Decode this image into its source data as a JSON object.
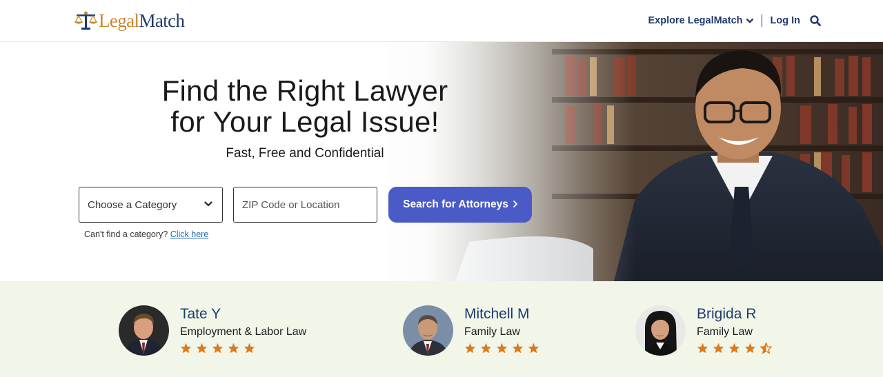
{
  "header": {
    "logo_part1": "Legal",
    "logo_part2": "Match",
    "nav_explore": "Explore LegalMatch",
    "nav_login": "Log In",
    "icons": [
      "scales-icon",
      "chevron-down-icon",
      "search-icon"
    ]
  },
  "hero": {
    "title_line1": "Find the Right Lawyer",
    "title_line2": "for Your Legal Issue!",
    "subtitle": "Fast, Free and Confidential",
    "category_select": "Choose a Category",
    "zip_placeholder": "ZIP Code or Location",
    "search_button": "Search for Attorneys",
    "cant_find_text": "Can't find a category?",
    "cant_find_link": "Click here"
  },
  "lawyers": [
    {
      "name": "Tate Y",
      "area": "Employment & Labor Law",
      "rating": 5
    },
    {
      "name": "Mitchell M",
      "area": "Family Law",
      "rating": 5
    },
    {
      "name": "Brigida R",
      "area": "Family Law",
      "rating": 4.5
    }
  ],
  "colors": {
    "brand_navy": "#1f3a6e",
    "brand_gold": "#c9872a",
    "button_blue": "#4a5bc8",
    "star_orange": "#e07a18",
    "strip_bg": "#f1f6e8"
  }
}
